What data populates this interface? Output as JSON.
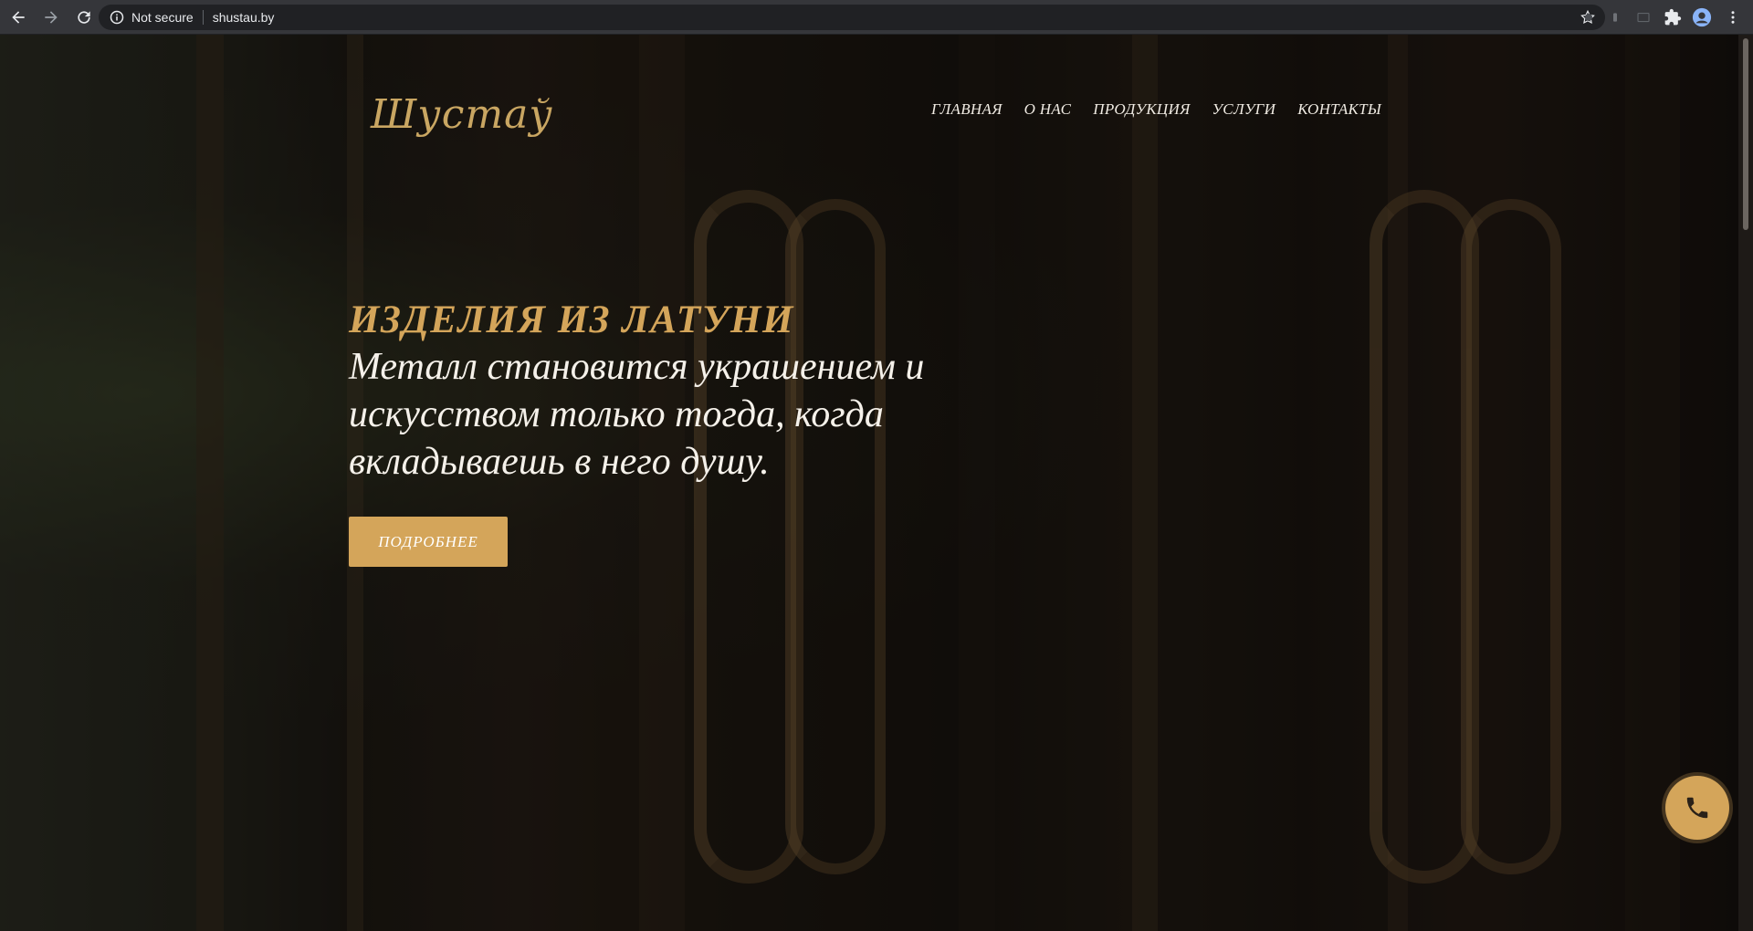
{
  "browser": {
    "security_label": "Not secure",
    "url": "shustau.by",
    "icons": [
      "back-icon",
      "forward-icon",
      "reload-icon",
      "info-icon",
      "star-icon",
      "extensions-icon",
      "profile-icon",
      "menu-icon"
    ]
  },
  "site": {
    "logo_text": "Шустаў",
    "nav": [
      {
        "label": "ГЛАВНАЯ"
      },
      {
        "label": "О НАС"
      },
      {
        "label": "ПРОДУКЦИЯ"
      },
      {
        "label": "УСЛУГИ"
      },
      {
        "label": "КОНТАКТЫ"
      }
    ]
  },
  "hero": {
    "title": "ИЗДЕЛИЯ ИЗ ЛАТУНИ",
    "subtitle": "Металл становится украшением и искусством только тогда, когда вкладываешь в него душу.",
    "cta_label": "ПОДРОБНЕЕ"
  },
  "colors": {
    "accent": "#d4a55a",
    "nav_text": "#f1ece4",
    "chrome_bg": "#35363a"
  },
  "floating": {
    "phone_icon": "phone-icon"
  }
}
